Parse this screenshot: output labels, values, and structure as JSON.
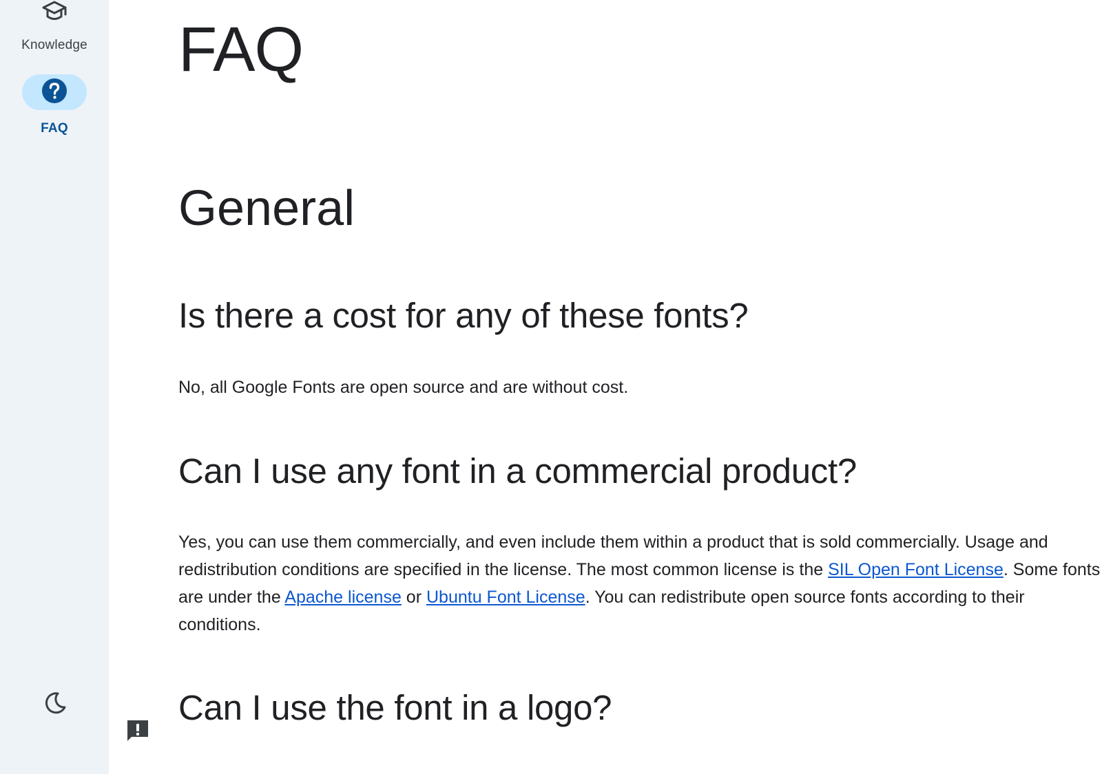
{
  "sidebar": {
    "items": [
      {
        "label": "Knowledge",
        "icon": "graduation-cap-icon"
      },
      {
        "label": "FAQ",
        "icon": "help-circle-icon"
      }
    ],
    "theme_toggle_icon": "moon-icon",
    "feedback_icon": "feedback-icon"
  },
  "colors": {
    "sidebar_bg": "#eef3f8",
    "active_pill": "#c2e7ff",
    "active_label": "#0b5394",
    "link": "#0b57d0",
    "text": "#202124"
  },
  "main": {
    "title": "FAQ",
    "section_title": "General",
    "faq": [
      {
        "question": "Is there a cost for any of these fonts?",
        "answer": "No, all Google Fonts are open source and are without cost."
      },
      {
        "question": "Can I use any font in a commercial product?",
        "answer_lines": {
          "line1": "Yes, you can use them commercially, and even include them within a product that is sold commercially. Usage and",
          "line2_pre": "redistribution conditions are specified in the license. The most common license is the ",
          "link_ofl": "SIL Open Font License",
          "line2_post": ". Some fonts",
          "line3_pre": "are under the ",
          "link_apache": "Apache license",
          "line3_mid": " or ",
          "link_ubuntu": "Ubuntu Font License",
          "line3_post": ". You can redistribute open source fonts according to their",
          "line4": "conditions."
        }
      },
      {
        "question": "Can I use the font in a logo?"
      }
    ]
  }
}
